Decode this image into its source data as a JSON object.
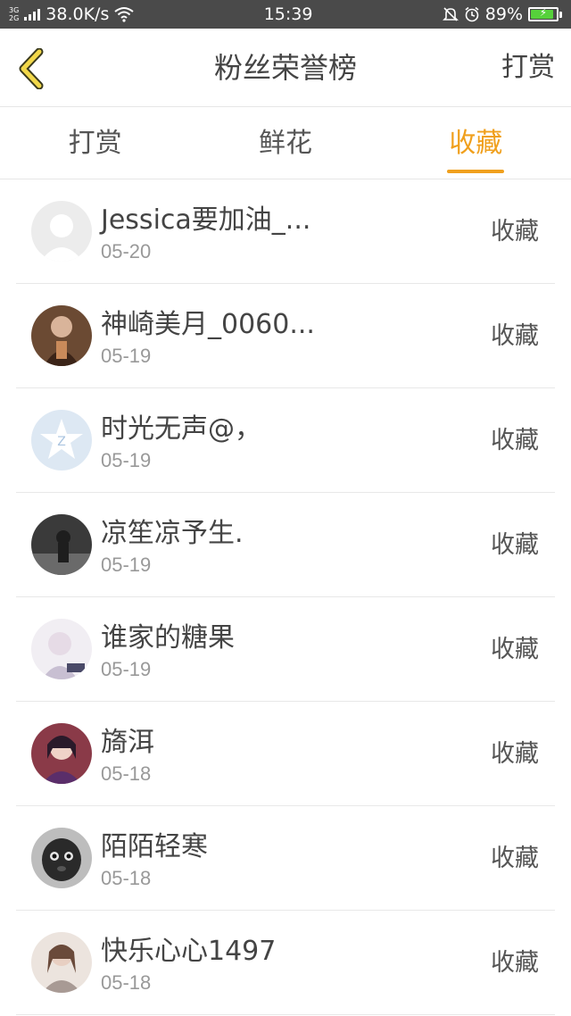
{
  "status_bar": {
    "network_top": "3G",
    "network_bottom": "2G",
    "speed": "38.0K/s",
    "time": "15:39",
    "battery": "89%",
    "icons": [
      "signal-icon",
      "wifi-icon",
      "mute-icon",
      "alarm-icon",
      "battery-charging-icon"
    ]
  },
  "header": {
    "back_icon": "chevron-left-icon",
    "title": "粉丝荣誉榜",
    "right_button": "打赏"
  },
  "tabs": [
    {
      "label": "打赏",
      "active": false
    },
    {
      "label": "鲜花",
      "active": false
    },
    {
      "label": "收藏",
      "active": true
    }
  ],
  "accent_color": "#f0a01e",
  "fans": [
    {
      "name": "Jessica要加油_...",
      "date": "05-20",
      "action": "收藏"
    },
    {
      "name": "神崎美月_0060...",
      "date": "05-19",
      "action": "收藏"
    },
    {
      "name": "时光无声@，",
      "date": "05-19",
      "action": "收藏"
    },
    {
      "name": "凉笙凉予生.",
      "date": "05-19",
      "action": "收藏"
    },
    {
      "name": "谁家的糖果",
      "date": "05-19",
      "action": "收藏"
    },
    {
      "name": "旖洱",
      "date": "05-18",
      "action": "收藏"
    },
    {
      "name": "陌陌轻寒",
      "date": "05-18",
      "action": "收藏"
    },
    {
      "name": "快乐心心1497",
      "date": "05-18",
      "action": "收藏"
    }
  ]
}
